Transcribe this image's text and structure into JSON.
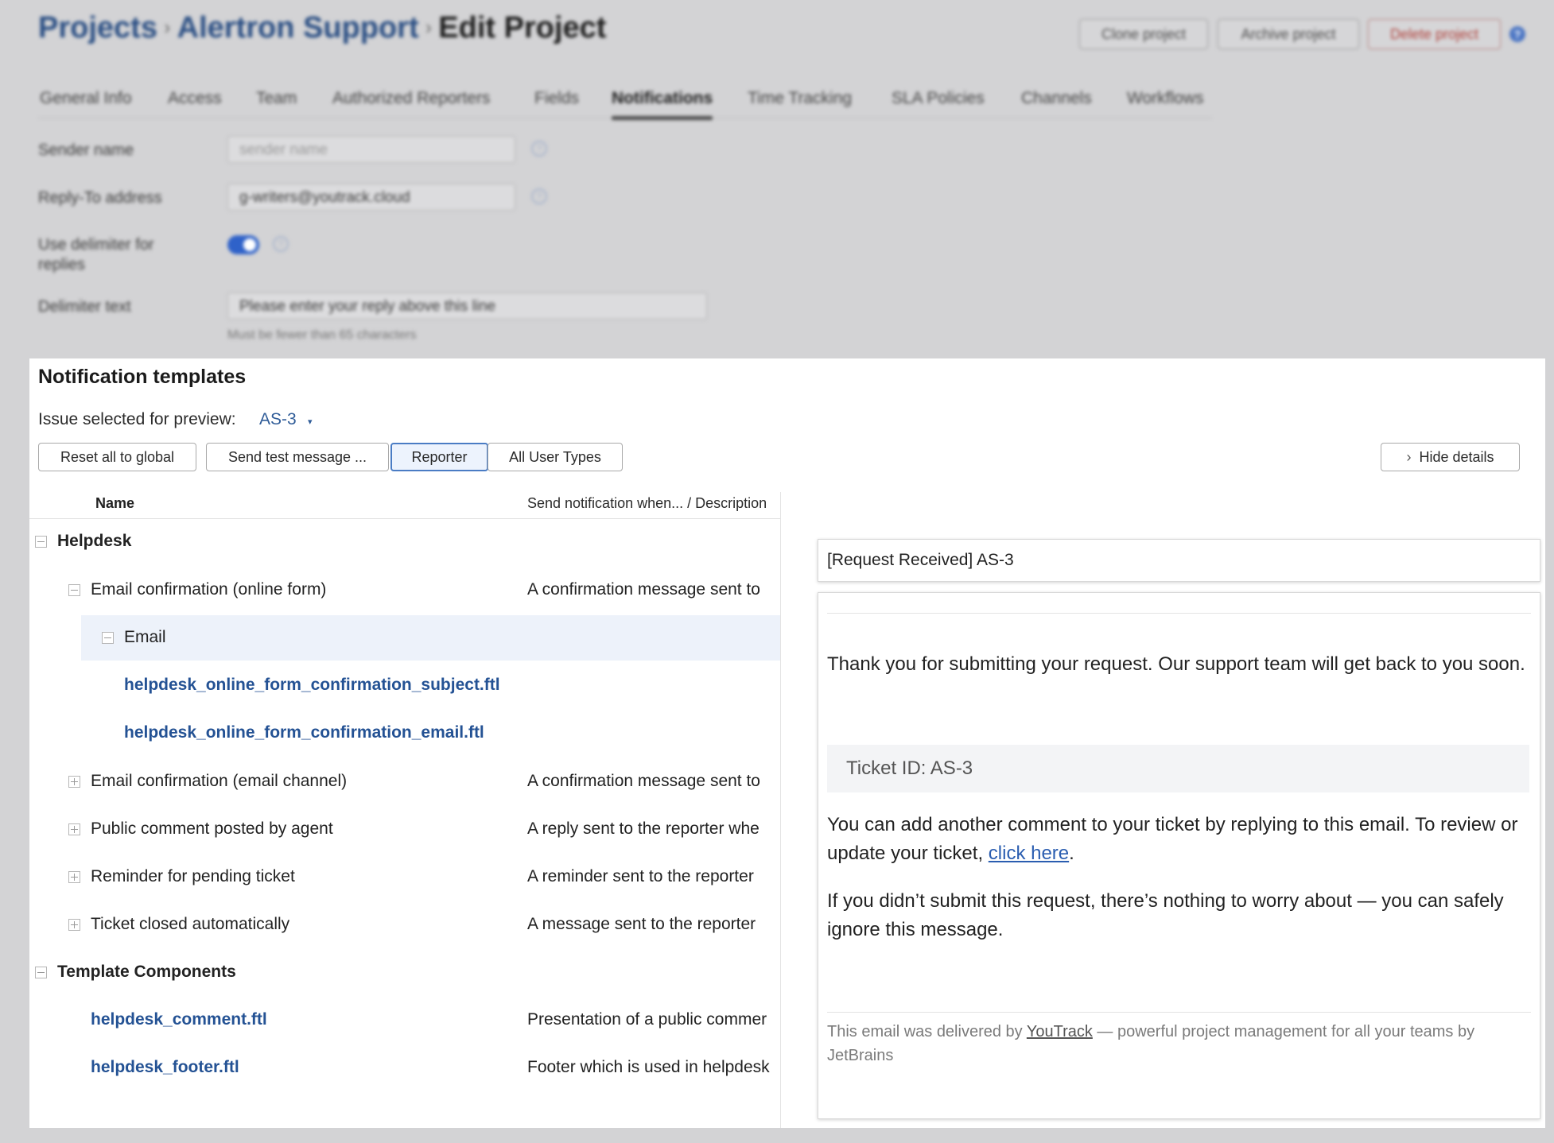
{
  "breadcrumb": {
    "projects": "Projects",
    "project": "Alertron Support",
    "current": "Edit Project",
    "separator": "›"
  },
  "header_actions": {
    "clone": "Clone project",
    "archive": "Archive project",
    "delete": "Delete project",
    "help": "?"
  },
  "tabs": [
    "General Info",
    "Access",
    "Team",
    "Authorized Reporters",
    "Fields",
    "Notifications",
    "Time Tracking",
    "SLA Policies",
    "Channels",
    "Workflows"
  ],
  "settings": {
    "sender_label": "Sender name",
    "sender_placeholder": "sender name",
    "reply_label": "Reply-To address",
    "reply_value": "g-writers@youtrack.cloud",
    "delimiter_use_label_1": "Use delimiter for",
    "delimiter_use_label_2": "replies",
    "delimiter_enabled": true,
    "delimiter_label": "Delimiter text",
    "delimiter_value": "Please enter your reply above this line",
    "delimiter_hint": "Must be fewer than 65 characters",
    "help": "?"
  },
  "templates": {
    "title": "Notification templates",
    "issue_label": "Issue selected for preview:",
    "issue_value": "AS-3",
    "caret": "▾",
    "buttons": {
      "reset": "Reset all to global",
      "send_test": "Send test message ...",
      "reporter": "Reporter",
      "all_user_types": "All User Types",
      "hide_details": "Hide details",
      "hide_chevron": "›"
    },
    "columns": {
      "name": "Name",
      "description": "Send notification when... / Description"
    },
    "tree": {
      "helpdesk": "Helpdesk",
      "email_confirmation_online": "Email confirmation (online form)",
      "email_confirmation_online_desc": "A confirmation message sent to",
      "email": "Email",
      "subject_ftl": "helpdesk_online_form_confirmation_subject.ftl",
      "email_ftl": "helpdesk_online_form_confirmation_email.ftl",
      "email_confirmation_channel": "Email confirmation (email channel)",
      "email_confirmation_channel_desc": "A confirmation message sent to",
      "public_comment": "Public comment posted by agent",
      "public_comment_desc": "A reply sent to the reporter whe",
      "reminder": "Reminder for pending ticket",
      "reminder_desc": "A reminder sent to the reporter",
      "closed": "Ticket closed automatically",
      "closed_desc": "A message sent to the reporter",
      "components": "Template Components",
      "comment_ftl": "helpdesk_comment.ftl",
      "comment_ftl_desc": "Presentation of a public commer",
      "footer_ftl": "helpdesk_footer.ftl",
      "footer_ftl_desc": "Footer which is used in helpdesk"
    }
  },
  "preview": {
    "subject": "[Request Received] AS-3",
    "para1": "Thank you for submitting your request. Our support team will get back to you soon.",
    "ticket": "Ticket ID: AS-3",
    "para2_a": "You can add another comment to your ticket by replying to this email. To review or update your ticket, ",
    "para2_link": "click here",
    "para2_b": ".",
    "para3": "If you didn’t submit this request, there’s nothing to worry about — you can safely ignore this message.",
    "footer_a": "This email was delivered by ",
    "footer_link": "YouTrack",
    "footer_b": " — powerful project management for all your teams by JetBrains"
  },
  "colors": {
    "accent": "#2f5c98",
    "link": "#245294",
    "selected_row": "#edf2fa",
    "danger": "#b0403a"
  }
}
